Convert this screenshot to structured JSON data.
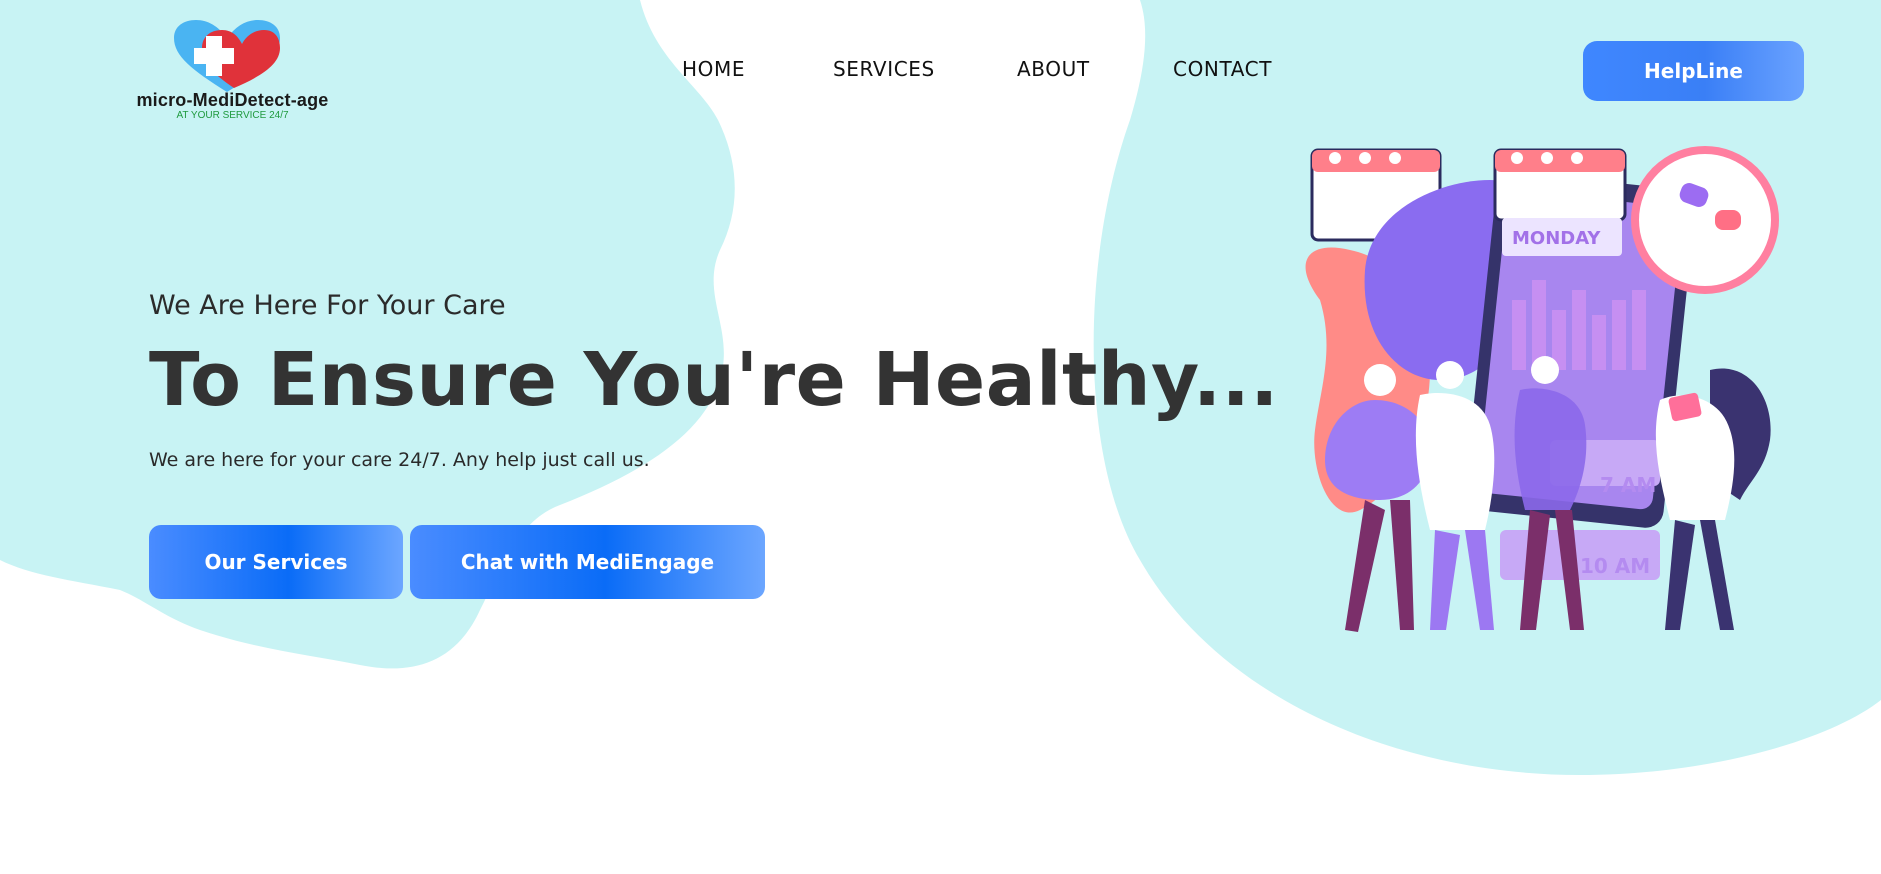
{
  "brand": {
    "name": "micro-MediDetect-age",
    "tagline": "AT YOUR SERVICE 24/7",
    "logo_icon": "heart-cross-icon"
  },
  "nav": {
    "items": [
      {
        "label": "HOME"
      },
      {
        "label": "SERVICES"
      },
      {
        "label": "ABOUT"
      },
      {
        "label": "CONTACT"
      }
    ],
    "helpline_label": "HelpLine"
  },
  "hero": {
    "subheading": "We Are Here For Your Care",
    "title": "To Ensure You're Healthy...",
    "description": "We are here for your care 24/7. Any help just call us.",
    "primary_button": "Our Services",
    "secondary_button": "Chat with MediEngage"
  },
  "illustration": {
    "icon": "medical-team-calendar-illustration",
    "day_label": "MONDAY",
    "time_1": "7 AM",
    "time_2": "10 AM"
  },
  "colors": {
    "background_blob": "#c8f3f4",
    "button_blue": "#1b74f8",
    "heart_red": "#e0323a",
    "heart_blue": "#4ab4f2",
    "text_dark": "#333333",
    "tagline_green": "#1f9a3e"
  }
}
